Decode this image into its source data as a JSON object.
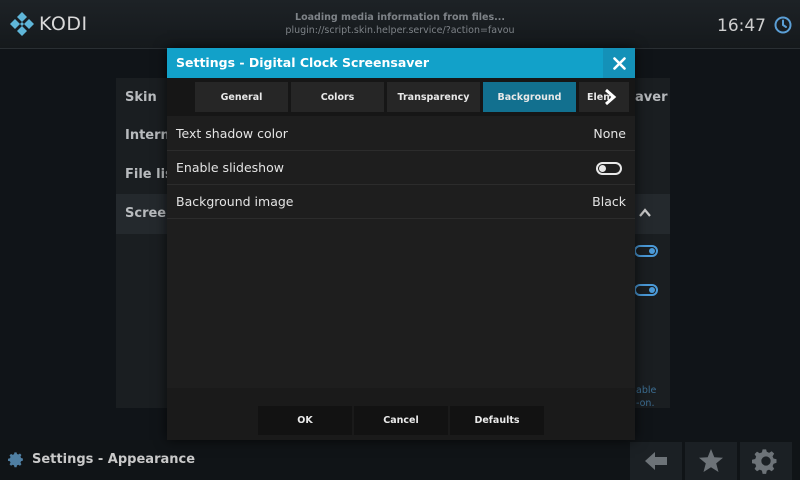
{
  "app": {
    "name": "KODI"
  },
  "topbar": {
    "loading_line1": "Loading media information from files...",
    "loading_line2": "plugin://script.skin.helper.service/?action=favou",
    "clock": "16:47"
  },
  "background": {
    "menu_items": [
      "Skin",
      "Interna",
      "File lis",
      "Screen"
    ],
    "right_heading": "aver",
    "right_text_1": "able",
    "right_text_2": "-on."
  },
  "bottombar": {
    "title": "Settings - Appearance"
  },
  "dialog": {
    "title": "Settings - Digital Clock Screensaver",
    "tabs": [
      "General",
      "Colors",
      "Transparency",
      "Background",
      "Elem"
    ],
    "active_tab": "Background",
    "settings": [
      {
        "label": "Text shadow color",
        "value": "None"
      },
      {
        "label": "Enable slideshow",
        "value": "",
        "toggle": false
      },
      {
        "label": "Background image",
        "value": "Black"
      }
    ],
    "buttons": {
      "ok": "OK",
      "cancel": "Cancel",
      "defaults": "Defaults"
    }
  },
  "colors": {
    "accent": "#12a1c9",
    "active_tab": "#12708f",
    "toggle_on": "#4b9ad8"
  },
  "icons": [
    "kodi-logo-icon",
    "clock-icon",
    "close-icon",
    "chevron-right-icon",
    "chevron-up-icon",
    "gear-icon",
    "back-arrow-icon",
    "star-icon"
  ]
}
